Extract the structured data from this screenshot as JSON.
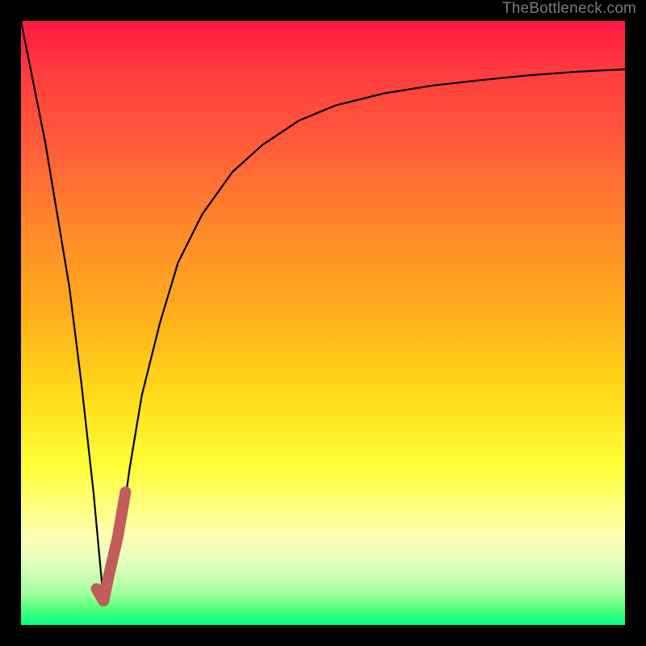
{
  "watermark": "TheBottleneck.com",
  "colors": {
    "frame": "#000000",
    "curve_thin": "#000000",
    "curve_thick": "#c25b5c",
    "watermark_text": "#7a7a7a"
  },
  "chart_data": {
    "type": "line",
    "title": "",
    "xlabel": "",
    "ylabel": "",
    "xlim": [
      0,
      100
    ],
    "ylim": [
      0,
      100
    ],
    "grid": false,
    "legend": false,
    "annotations": [],
    "series": [
      {
        "name": "bottleneck-curve",
        "stroke": "thin-black",
        "x": [
          0.0,
          2.0,
          4.0,
          6.0,
          8.0,
          10.0,
          12.0,
          13.67,
          16.0,
          18.0,
          20.0,
          23.0,
          26.0,
          30.0,
          35.0,
          40.0,
          46.0,
          52.0,
          60.0,
          68.0,
          76.0,
          84.0,
          92.0,
          100.0
        ],
        "y": [
          100.0,
          90.0,
          80.0,
          68.0,
          56.0,
          40.0,
          22.0,
          4.0,
          12.0,
          26.0,
          38.0,
          50.0,
          60.0,
          68.0,
          75.0,
          79.5,
          83.5,
          86.0,
          88.0,
          89.3,
          90.2,
          91.0,
          91.6,
          92.0
        ]
      },
      {
        "name": "bottleneck-highlight",
        "stroke": "thick-red",
        "x": [
          12.5,
          13.67,
          14.5,
          16.0,
          17.3
        ],
        "y": [
          6.0,
          4.0,
          8.0,
          14.5,
          22.0
        ]
      }
    ],
    "background_gradient": {
      "direction": "vertical",
      "stops": [
        {
          "pos": 0.0,
          "color": "#ff1744"
        },
        {
          "pos": 0.08,
          "color": "#ff3b3f"
        },
        {
          "pos": 0.2,
          "color": "#ff5a3a"
        },
        {
          "pos": 0.35,
          "color": "#ff8a2a"
        },
        {
          "pos": 0.5,
          "color": "#ffb21a"
        },
        {
          "pos": 0.63,
          "color": "#ffde1a"
        },
        {
          "pos": 0.74,
          "color": "#ffff3a"
        },
        {
          "pos": 0.8,
          "color": "#ffff7a"
        },
        {
          "pos": 0.85,
          "color": "#ffffb0"
        },
        {
          "pos": 0.89,
          "color": "#e8ffc0"
        },
        {
          "pos": 0.92,
          "color": "#c8ffb0"
        },
        {
          "pos": 0.95,
          "color": "#9cff9c"
        },
        {
          "pos": 0.975,
          "color": "#4cff78"
        },
        {
          "pos": 1.0,
          "color": "#00ff88"
        }
      ]
    }
  }
}
